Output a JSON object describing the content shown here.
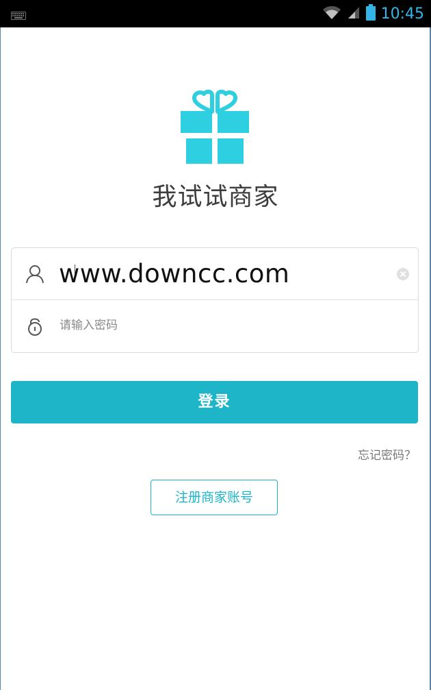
{
  "status_bar": {
    "time": "10:45",
    "accent": "#33b5e5",
    "icons": [
      "keyboard-icon",
      "wifi-icon",
      "signal-icon",
      "battery-icon"
    ]
  },
  "app": {
    "title": "我试试商家",
    "logo": "gift-box-icon",
    "brand_color": "#2ecfe0"
  },
  "login_form": {
    "username": {
      "icon": "user-icon",
      "value": "",
      "placeholder": "",
      "clear_icon": "clear-icon"
    },
    "password": {
      "icon": "lock-icon",
      "placeholder": "请输入密码"
    }
  },
  "watermark": "www.downcc.com",
  "buttons": {
    "login": "登录",
    "forgot_password": "忘记密码？",
    "register": "注册商家账号",
    "primary_color": "#1fb5c9"
  }
}
